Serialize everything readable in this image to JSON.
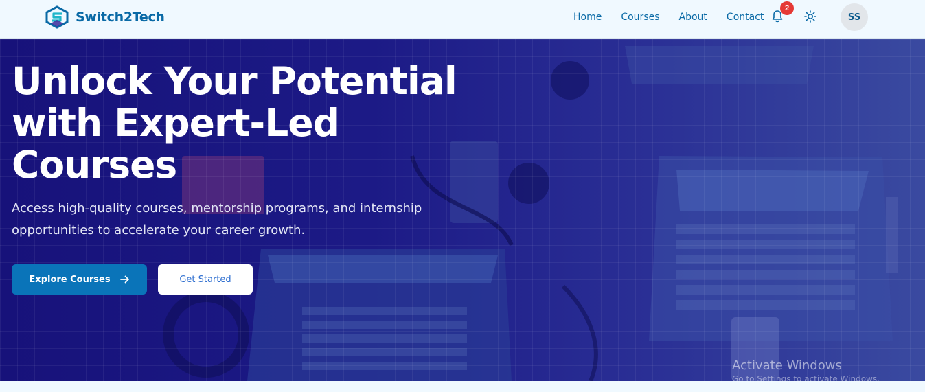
{
  "brand": {
    "name": "Switch2Tech",
    "icon": "logo-s-hexagon-icon",
    "color": "#0a6aa6"
  },
  "nav": {
    "items": [
      {
        "label": "Home"
      },
      {
        "label": "Courses"
      },
      {
        "label": "About"
      },
      {
        "label": "Contact"
      }
    ]
  },
  "notifications": {
    "count": "2",
    "icon": "bell-icon",
    "badge_color": "#e53935"
  },
  "theme_toggle": {
    "icon": "sun-icon"
  },
  "user": {
    "initials": "SS"
  },
  "hero": {
    "title_line1": "Unlock Your Potential",
    "title_line2": "with Expert-Led",
    "title_line3": "Courses",
    "subtitle_line1": "Access high-quality courses, mentorship programs, and internship",
    "subtitle_line2": "opportunities to accelerate your career growth.",
    "primary_button": "Explore Courses",
    "primary_icon": "arrow-right-icon",
    "secondary_button": "Get Started",
    "accent_color": "#0a74b9"
  },
  "watermark": {
    "line1": "Activate Windows",
    "line2": "Go to Settings to activate Windows."
  }
}
